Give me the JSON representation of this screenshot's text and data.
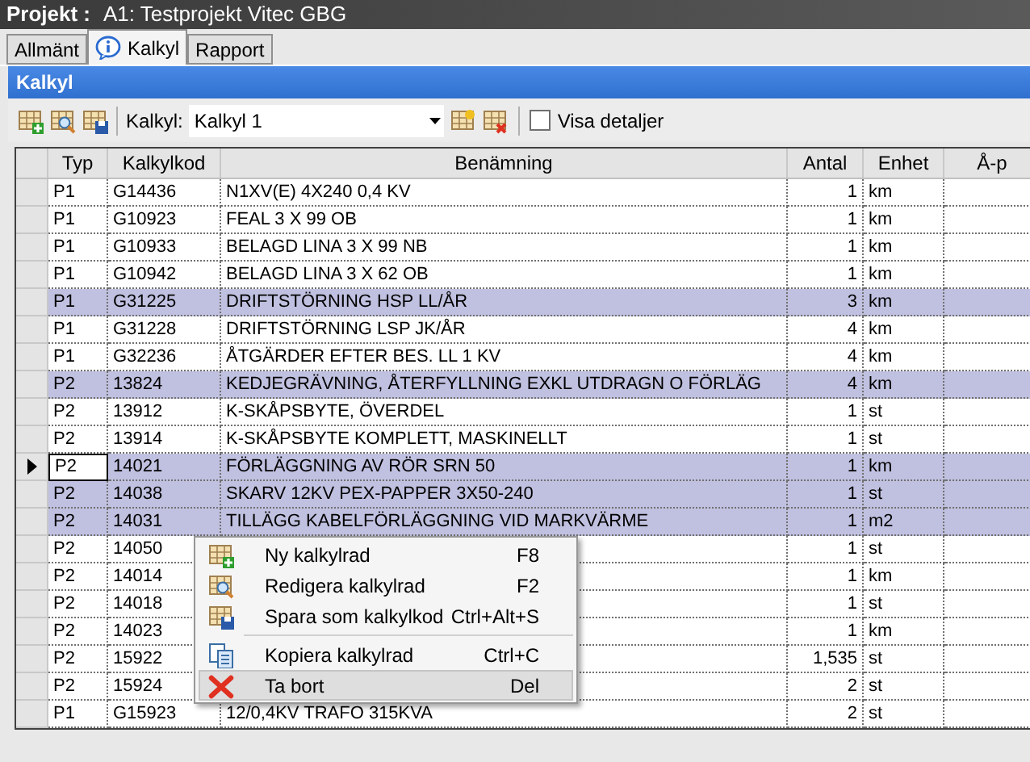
{
  "title_bar": {
    "label": "Projekt :",
    "value": "A1: Testprojekt Vitec GBG"
  },
  "tabs": [
    {
      "label": "Allmänt",
      "selected": false
    },
    {
      "label": "Kalkyl",
      "selected": true
    },
    {
      "label": "Rapport",
      "selected": false
    }
  ],
  "panel": {
    "title": "Kalkyl"
  },
  "toolbar": {
    "combo_label": "Kalkyl:",
    "combo_value": "Kalkyl 1",
    "checkbox": {
      "label": "Visa detaljer",
      "checked": false
    }
  },
  "table": {
    "columns": [
      "Typ",
      "Kalkylkod",
      "Benämning",
      "Antal",
      "Enhet",
      "Å-p"
    ],
    "rows": [
      {
        "typ": "P1",
        "kod": "G14436",
        "benamning": "N1XV(E)  4X240 0,4 KV",
        "antal": "1",
        "enhet": "km",
        "selected": false,
        "current": false
      },
      {
        "typ": "P1",
        "kod": "G10923",
        "benamning": "FEAL 3 X 99  OB",
        "antal": "1",
        "enhet": "km",
        "selected": false,
        "current": false
      },
      {
        "typ": "P1",
        "kod": "G10933",
        "benamning": "BELAGD LINA 3 X 99 NB",
        "antal": "1",
        "enhet": "km",
        "selected": false,
        "current": false
      },
      {
        "typ": "P1",
        "kod": "G10942",
        "benamning": "BELAGD LINA 3 X 62 OB",
        "antal": "1",
        "enhet": "km",
        "selected": false,
        "current": false
      },
      {
        "typ": "P1",
        "kod": "G31225",
        "benamning": "DRIFTSTÖRNING HSP LL/ÅR",
        "antal": "3",
        "enhet": "km",
        "selected": true,
        "current": false
      },
      {
        "typ": "P1",
        "kod": "G31228",
        "benamning": "DRIFTSTÖRNING LSP JK/ÅR",
        "antal": "4",
        "enhet": "km",
        "selected": false,
        "current": false
      },
      {
        "typ": "P1",
        "kod": "G32236",
        "benamning": "ÅTGÄRDER EFTER BES. LL 1 KV",
        "antal": "4",
        "enhet": "km",
        "selected": false,
        "current": false
      },
      {
        "typ": "P2",
        "kod": "13824",
        "benamning": "KEDJEGRÄVNING,  ÅTERFYLLNING  EXKL  UTDRAGN  O FÖRLÄG",
        "antal": "4",
        "enhet": "km",
        "selected": true,
        "current": false
      },
      {
        "typ": "P2",
        "kod": "13912",
        "benamning": "K-SKÅPSBYTE, ÖVERDEL",
        "antal": "1",
        "enhet": "st",
        "selected": false,
        "current": false
      },
      {
        "typ": "P2",
        "kod": "13914",
        "benamning": "K-SKÅPSBYTE KOMPLETT, MASKINELLT",
        "antal": "1",
        "enhet": "st",
        "selected": false,
        "current": false
      },
      {
        "typ": "P2",
        "kod": "14021",
        "benamning": "FÖRLÄGGNING AV RÖR SRN 50",
        "antal": "1",
        "enhet": "km",
        "selected": true,
        "current": true
      },
      {
        "typ": "P2",
        "kod": "14038",
        "benamning": "SKARV 12KV PEX-PAPPER 3X50-240",
        "antal": "1",
        "enhet": "st",
        "selected": true,
        "current": false
      },
      {
        "typ": "P2",
        "kod": "14031",
        "benamning": "TILLÄGG KABELFÖRLÄGGNING VID MARKVÄRME",
        "antal": "1",
        "enhet": "m2",
        "selected": true,
        "current": false
      },
      {
        "typ": "P2",
        "kod": "14050",
        "antal": "1",
        "enhet": "st",
        "selected": false,
        "current": false
      },
      {
        "typ": "P2",
        "kod": "14014",
        "antal": "1",
        "enhet": "km",
        "selected": false,
        "current": false
      },
      {
        "typ": "P2",
        "kod": "14018",
        "antal": "1",
        "enhet": "st",
        "selected": false,
        "current": false
      },
      {
        "typ": "P2",
        "kod": "14023",
        "antal": "1",
        "enhet": "km",
        "selected": false,
        "current": false
      },
      {
        "typ": "P2",
        "kod": "15922",
        "antal": "1,535",
        "enhet": "st",
        "selected": false,
        "current": false
      },
      {
        "typ": "P2",
        "kod": "15924",
        "antal": "2",
        "enhet": "st",
        "selected": false,
        "current": false
      },
      {
        "typ": "P1",
        "kod": "G15923",
        "benamning": "12/0,4KV TRAFO 315KVA",
        "antal": "2",
        "enhet": "st",
        "selected": false,
        "current": false
      }
    ]
  },
  "context_menu": {
    "items": [
      {
        "kind": "item",
        "label": "Ny kalkylrad",
        "shortcut": "F8",
        "highlighted": false
      },
      {
        "kind": "item",
        "label": "Redigera kalkylrad",
        "shortcut": "F2",
        "highlighted": false
      },
      {
        "kind": "item",
        "label": "Spara som kalkylkod",
        "shortcut": "Ctrl+Alt+S",
        "highlighted": false
      },
      {
        "kind": "separator"
      },
      {
        "kind": "item",
        "label": "Kopiera kalkylrad",
        "shortcut": "Ctrl+C",
        "highlighted": false
      },
      {
        "kind": "item",
        "label": "Ta bort",
        "shortcut": "Del",
        "highlighted": true
      }
    ]
  }
}
